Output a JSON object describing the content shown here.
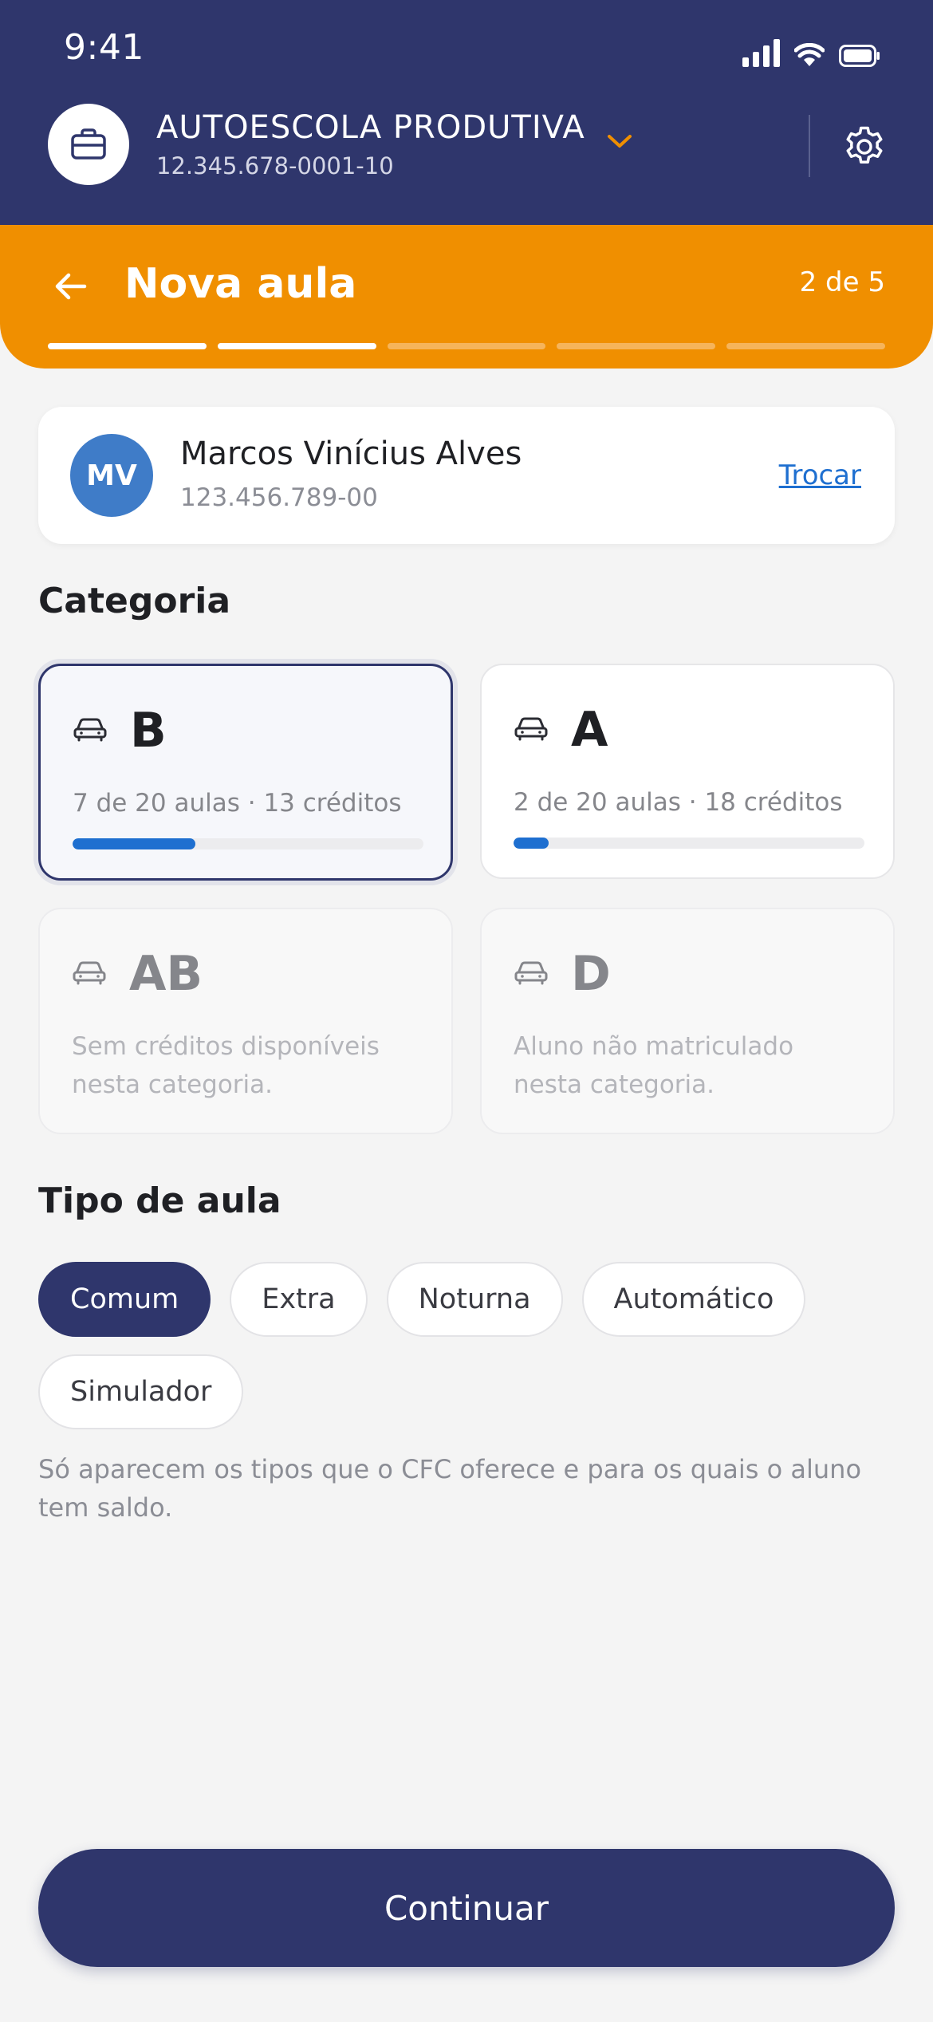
{
  "status_bar": {
    "time": "9:41"
  },
  "company": {
    "name": "AUTOESCOLA PRODUTIVA",
    "cnpj": "12.345.678-0001-10"
  },
  "flow": {
    "title": "Nova aula",
    "step_label": "2 de 5",
    "current_step": 2,
    "total_steps": 5
  },
  "student": {
    "initials": "MV",
    "name": "Marcos Vinícius Alves",
    "cpf": "123.456.789-00",
    "swap_label": "Trocar"
  },
  "category_section": {
    "title": "Categoria",
    "items": [
      {
        "letter": "B",
        "subtitle": "7 de 20 aulas · 13 créditos",
        "progress": 0.35,
        "state": "selected"
      },
      {
        "letter": "A",
        "subtitle": "2 de 20 aulas · 18 créditos",
        "progress": 0.1,
        "state": "available"
      },
      {
        "letter": "AB",
        "subtitle": "Sem créditos disponíveis nesta categoria.",
        "state": "disabled"
      },
      {
        "letter": "D",
        "subtitle": "Aluno não matriculado nesta categoria.",
        "state": "disabled"
      }
    ]
  },
  "lesson_type": {
    "title": "Tipo de aula",
    "options": [
      "Comum",
      "Extra",
      "Noturna",
      "Automático",
      "Simulador"
    ],
    "selected": "Comum",
    "hint": "Só aparecem os tipos que o CFC oferece e para os quais o aluno tem saldo."
  },
  "continue_label": "Continuar",
  "colors": {
    "primary": "#2f366c",
    "accent": "#f08f00",
    "link": "#1e6fd0"
  }
}
